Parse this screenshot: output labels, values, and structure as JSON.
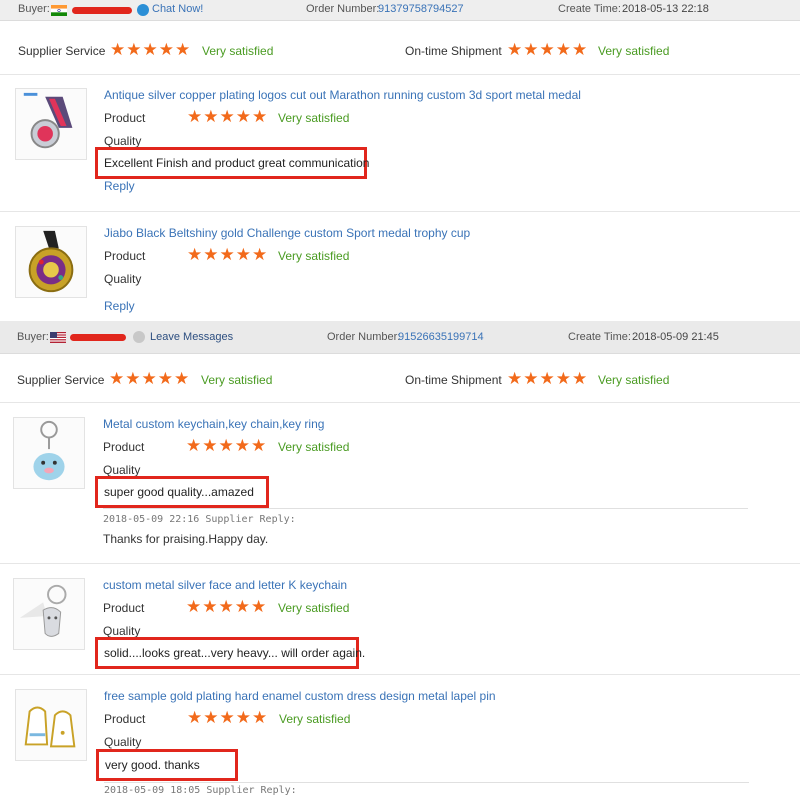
{
  "orders": [
    {
      "buyer_label": "Buyer:",
      "contact_label": "Chat Now!",
      "order_number_label": "Order Number:",
      "order_number": "91379758794527",
      "create_time_label": "Create Time:",
      "create_time": "2018-05-13 22:18",
      "supplier_service_label": "Supplier Service",
      "supplier_service_rating": "Very satisfied",
      "ontime_label": "On-time Shipment",
      "ontime_rating": "Very satisfied",
      "items": [
        {
          "title": "Antique silver copper plating logos cut out Marathon running custom 3d sport metal medal",
          "product_label": "Product",
          "product_rating": "Very satisfied",
          "quality_label": "Quality",
          "review": "Excellent Finish and product great communication",
          "reply_label": "Reply"
        },
        {
          "title": "Jiabo Black Beltshiny gold Challenge custom Sport medal trophy cup",
          "product_label": "Product",
          "product_rating": "Very satisfied",
          "quality_label": "Quality",
          "reply_label": "Reply"
        }
      ]
    },
    {
      "buyer_label": "Buyer:",
      "contact_label": "Leave Messages",
      "order_number_label": "Order Number:",
      "order_number": "91526635199714",
      "create_time_label": "Create Time:",
      "create_time": "2018-05-09 21:45",
      "supplier_service_label": "Supplier Service",
      "supplier_service_rating": "Very satisfied",
      "ontime_label": "On-time Shipment",
      "ontime_rating": "Very satisfied",
      "items": [
        {
          "title": "Metal custom keychain,key chain,key ring",
          "product_label": "Product",
          "product_rating": "Very satisfied",
          "quality_label": "Quality",
          "review": "super good quality...amazed",
          "supplier_reply_meta": "2018-05-09 22:16  Supplier Reply:",
          "supplier_reply": "Thanks for praising.Happy day."
        },
        {
          "title": "custom metal silver face and letter K keychain",
          "product_label": "Product",
          "product_rating": "Very satisfied",
          "quality_label": "Quality",
          "review": "solid....looks great...very heavy... will order again."
        },
        {
          "title": "free sample gold plating hard enamel custom dress design metal lapel pin",
          "product_label": "Product",
          "product_rating": "Very satisfied",
          "quality_label": "Quality",
          "review": "very good. thanks",
          "supplier_reply_meta": "2018-05-09 18:05  Supplier Reply:"
        }
      ]
    }
  ],
  "stars_glyph": "★★★★★",
  "icons": {
    "buyer_flag_1": "india-flag-icon",
    "buyer_flag_2": "usa-flag-icon",
    "chat": "chat-icon",
    "message": "message-icon"
  },
  "colors": {
    "star": "#f26a1b",
    "satisfied": "#4a9b22",
    "link": "#3a73b7",
    "highlight_box": "#e1261c",
    "order_bar": "#eeeeee"
  }
}
